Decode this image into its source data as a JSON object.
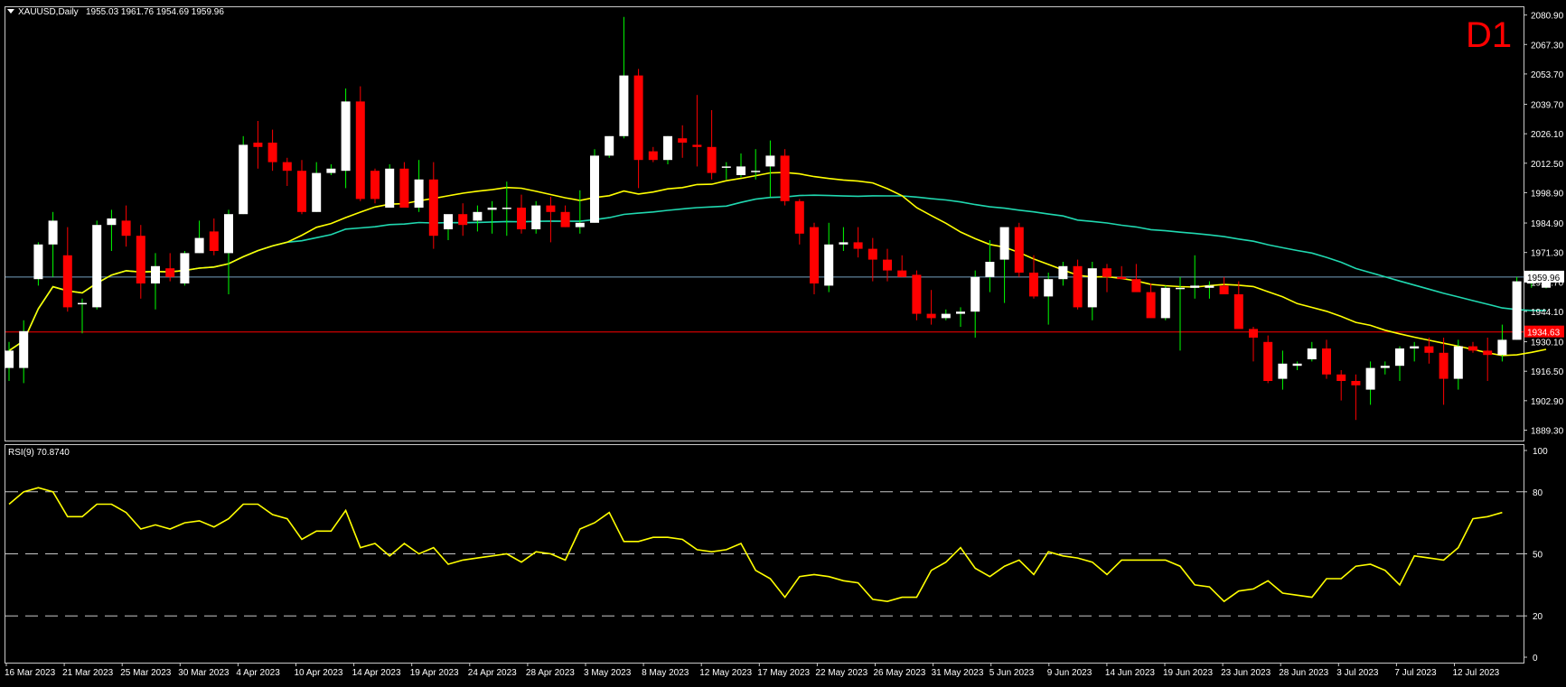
{
  "header": {
    "symbol": "XAUUSD,Daily",
    "ohlc": "1955.03 1961.76 1954.69 1959.96",
    "timeframe_badge": "D1",
    "rsi_label": "RSI(9) 70.8740"
  },
  "colors": {
    "background": "#000000",
    "frame": "#c8c8c8",
    "bull": "#ffffff",
    "bear": "#ff0000",
    "wick_up": "#00ff00",
    "wick_down": "#ff0000",
    "ma_fast": "#ffff00",
    "ma_slow": "#20d8b0",
    "rsi": "#ffff00",
    "badge": "#ff0000",
    "ref_line_red": "#ff0000",
    "ref_line_blue": "#9fd8ff"
  },
  "chart_data": [
    {
      "type": "candlestick",
      "ylim": [
        1884.5,
        2084.5
      ],
      "y_ticks": [
        "2080.90",
        "2067.30",
        "2053.70",
        "2039.70",
        "2026.10",
        "2012.50",
        "1998.90",
        "1984.90",
        "1971.30",
        "1957.70",
        "1944.10",
        "1930.10",
        "1916.50",
        "1902.90",
        "1889.30"
      ],
      "x_ticks": [
        "16 Mar 2023",
        "21 Mar 2023",
        "25 Mar 2023",
        "30 Mar 2023",
        "4 Apr 2023",
        "10 Apr 2023",
        "14 Apr 2023",
        "19 Apr 2023",
        "24 Apr 2023",
        "28 Apr 2023",
        "3 May 2023",
        "8 May 2023",
        "12 May 2023",
        "17 May 2023",
        "22 May 2023",
        "26 May 2023",
        "31 May 2023",
        "5 Jun 2023",
        "9 Jun 2023",
        "14 Jun 2023",
        "19 Jun 2023",
        "23 Jun 2023",
        "28 Jun 2023",
        "3 Jul 2023",
        "7 Jul 2023",
        "12 Jul 2023"
      ],
      "price_labels": [
        {
          "value": 1959.96,
          "text": "1959.96",
          "role": "current"
        },
        {
          "value": 1934.63,
          "text": "1934.63",
          "role": "reference"
        }
      ],
      "series": [
        {
          "name": "XAUUSD,Daily",
          "candles": [
            {
              "o": 1918,
              "h": 1930,
              "l": 1912,
              "c": 1926
            },
            {
              "o": 1918,
              "h": 1940,
              "l": 1911,
              "c": 1935
            },
            {
              "o": 1959,
              "h": 1976,
              "l": 1956,
              "c": 1975
            },
            {
              "o": 1975,
              "h": 1990,
              "l": 1960,
              "c": 1986
            },
            {
              "o": 1970,
              "h": 1983,
              "l": 1944,
              "c": 1946
            },
            {
              "o": 1948,
              "h": 1950,
              "l": 1934,
              "c": 1948
            },
            {
              "o": 1946,
              "h": 1986,
              "l": 1945,
              "c": 1984
            },
            {
              "o": 1984,
              "h": 1991,
              "l": 1972,
              "c": 1987
            },
            {
              "o": 1986,
              "h": 1993,
              "l": 1974,
              "c": 1979
            },
            {
              "o": 1979,
              "h": 1984,
              "l": 1950,
              "c": 1957
            },
            {
              "o": 1957,
              "h": 1971,
              "l": 1945,
              "c": 1965
            },
            {
              "o": 1964,
              "h": 1971,
              "l": 1958,
              "c": 1960
            },
            {
              "o": 1957,
              "h": 1972,
              "l": 1956,
              "c": 1971
            },
            {
              "o": 1971,
              "h": 1986,
              "l": 1971,
              "c": 1978
            },
            {
              "o": 1981,
              "h": 1987,
              "l": 1970,
              "c": 1972
            },
            {
              "o": 1971,
              "h": 1991,
              "l": 1952,
              "c": 1989
            },
            {
              "o": 1989,
              "h": 2025,
              "l": 1989,
              "c": 2021
            },
            {
              "o": 2022,
              "h": 2032,
              "l": 2010,
              "c": 2020
            },
            {
              "o": 2022,
              "h": 2028,
              "l": 2009,
              "c": 2013
            },
            {
              "o": 2013,
              "h": 2015,
              "l": 2002,
              "c": 2009
            },
            {
              "o": 2009,
              "h": 2014,
              "l": 1989,
              "c": 1990
            },
            {
              "o": 1990,
              "h": 2013,
              "l": 1990,
              "c": 2008
            },
            {
              "o": 2008,
              "h": 2012,
              "l": 2007,
              "c": 2010
            },
            {
              "o": 2009,
              "h": 2047,
              "l": 2001,
              "c": 2041
            },
            {
              "o": 2041,
              "h": 2048,
              "l": 1995,
              "c": 1996
            },
            {
              "o": 2009,
              "h": 2010,
              "l": 1994,
              "c": 1996
            },
            {
              "o": 1992,
              "h": 2012,
              "l": 1995,
              "c": 2010
            },
            {
              "o": 2010,
              "h": 2013,
              "l": 1992,
              "c": 1992
            },
            {
              "o": 1992,
              "h": 2014,
              "l": 1990,
              "c": 2005
            },
            {
              "o": 2005,
              "h": 2013,
              "l": 1973,
              "c": 1979
            },
            {
              "o": 1982,
              "h": 1987,
              "l": 1977,
              "c": 1989
            },
            {
              "o": 1989,
              "h": 1994,
              "l": 1979,
              "c": 1984
            },
            {
              "o": 1986,
              "h": 1993,
              "l": 1981,
              "c": 1990
            },
            {
              "o": 1991,
              "h": 1995,
              "l": 1980,
              "c": 1992
            },
            {
              "o": 1992,
              "h": 2004,
              "l": 1979,
              "c": 1992
            },
            {
              "o": 1992,
              "h": 1998,
              "l": 1980,
              "c": 1982
            },
            {
              "o": 1982,
              "h": 1995,
              "l": 1980,
              "c": 1993
            },
            {
              "o": 1993,
              "h": 1997,
              "l": 1976,
              "c": 1990
            },
            {
              "o": 1990,
              "h": 1993,
              "l": 1983,
              "c": 1983
            },
            {
              "o": 1983,
              "h": 2000,
              "l": 1980,
              "c": 1985
            },
            {
              "o": 1985,
              "h": 2019,
              "l": 1985,
              "c": 2016
            },
            {
              "o": 2016,
              "h": 2025,
              "l": 2015,
              "c": 2025
            },
            {
              "o": 2025,
              "h": 2080,
              "l": 2024,
              "c": 2053
            },
            {
              "o": 2053,
              "h": 2056,
              "l": 2001,
              "c": 2014
            },
            {
              "o": 2018,
              "h": 2020,
              "l": 2013,
              "c": 2014
            },
            {
              "o": 2014,
              "h": 2025,
              "l": 2012,
              "c": 2025
            },
            {
              "o": 2024,
              "h": 2030,
              "l": 2015,
              "c": 2022
            },
            {
              "o": 2021,
              "h": 2044,
              "l": 2011,
              "c": 2020
            },
            {
              "o": 2020,
              "h": 2037,
              "l": 2005,
              "c": 2008
            },
            {
              "o": 2011,
              "h": 2013,
              "l": 2005,
              "c": 2011
            },
            {
              "o": 2007,
              "h": 2017,
              "l": 2006,
              "c": 2011
            },
            {
              "o": 2009,
              "h": 2019,
              "l": 2005,
              "c": 2009
            },
            {
              "o": 2011,
              "h": 2023,
              "l": 1997,
              "c": 2016
            },
            {
              "o": 2016,
              "h": 2019,
              "l": 1993,
              "c": 1995
            },
            {
              "o": 1995,
              "h": 1996,
              "l": 1975,
              "c": 1980
            },
            {
              "o": 1983,
              "h": 1985,
              "l": 1952,
              "c": 1957
            },
            {
              "o": 1956,
              "h": 1985,
              "l": 1953,
              "c": 1975
            },
            {
              "o": 1975,
              "h": 1983,
              "l": 1972,
              "c": 1976
            },
            {
              "o": 1976,
              "h": 1983,
              "l": 1969,
              "c": 1973
            },
            {
              "o": 1973,
              "h": 1978,
              "l": 1958,
              "c": 1968
            },
            {
              "o": 1968,
              "h": 1973,
              "l": 1958,
              "c": 1963
            },
            {
              "o": 1963,
              "h": 1970,
              "l": 1960,
              "c": 1960
            },
            {
              "o": 1961,
              "h": 1963,
              "l": 1940,
              "c": 1943
            },
            {
              "o": 1943,
              "h": 1954,
              "l": 1938,
              "c": 1941
            },
            {
              "o": 1941,
              "h": 1945,
              "l": 1940,
              "c": 1943
            },
            {
              "o": 1943,
              "h": 1946,
              "l": 1937,
              "c": 1944
            },
            {
              "o": 1944,
              "h": 1963,
              "l": 1932,
              "c": 1960
            },
            {
              "o": 1960,
              "h": 1977,
              "l": 1953,
              "c": 1967
            },
            {
              "o": 1968,
              "h": 1982,
              "l": 1948,
              "c": 1983
            },
            {
              "o": 1983,
              "h": 1985,
              "l": 1960,
              "c": 1962
            },
            {
              "o": 1962,
              "h": 1970,
              "l": 1950,
              "c": 1951
            },
            {
              "o": 1951,
              "h": 1962,
              "l": 1938,
              "c": 1959
            },
            {
              "o": 1959,
              "h": 1967,
              "l": 1956,
              "c": 1965
            },
            {
              "o": 1965,
              "h": 1968,
              "l": 1945,
              "c": 1946
            },
            {
              "o": 1946,
              "h": 1967,
              "l": 1940,
              "c": 1964
            },
            {
              "o": 1964,
              "h": 1966,
              "l": 1953,
              "c": 1960
            },
            {
              "o": 1960,
              "h": 1965,
              "l": 1959,
              "c": 1959
            },
            {
              "o": 1959,
              "h": 1966,
              "l": 1955,
              "c": 1953
            },
            {
              "o": 1953,
              "h": 1957,
              "l": 1943,
              "c": 1941
            },
            {
              "o": 1941,
              "h": 1956,
              "l": 1940,
              "c": 1955
            },
            {
              "o": 1955,
              "h": 1960,
              "l": 1926,
              "c": 1955
            },
            {
              "o": 1955,
              "h": 1970,
              "l": 1950,
              "c": 1956
            },
            {
              "o": 1955,
              "h": 1958,
              "l": 1950,
              "c": 1956
            },
            {
              "o": 1956,
              "h": 1960,
              "l": 1952,
              "c": 1952
            },
            {
              "o": 1952,
              "h": 1958,
              "l": 1943,
              "c": 1936
            },
            {
              "o": 1936,
              "h": 1937,
              "l": 1921,
              "c": 1932
            },
            {
              "o": 1930,
              "h": 1933,
              "l": 1911,
              "c": 1912
            },
            {
              "o": 1913,
              "h": 1926,
              "l": 1908,
              "c": 1920
            },
            {
              "o": 1919,
              "h": 1921,
              "l": 1917,
              "c": 1920
            },
            {
              "o": 1922,
              "h": 1930,
              "l": 1921,
              "c": 1927
            },
            {
              "o": 1927,
              "h": 1931,
              "l": 1913,
              "c": 1915
            },
            {
              "o": 1915,
              "h": 1917,
              "l": 1903,
              "c": 1912
            },
            {
              "o": 1912,
              "h": 1915,
              "l": 1894,
              "c": 1910
            },
            {
              "o": 1908,
              "h": 1921,
              "l": 1901,
              "c": 1918
            },
            {
              "o": 1918,
              "h": 1921,
              "l": 1915,
              "c": 1919
            },
            {
              "o": 1919,
              "h": 1928,
              "l": 1912,
              "c": 1927
            },
            {
              "o": 1927,
              "h": 1930,
              "l": 1921,
              "c": 1928
            },
            {
              "o": 1928,
              "h": 1932,
              "l": 1920,
              "c": 1925
            },
            {
              "o": 1925,
              "h": 1932,
              "l": 1901,
              "c": 1913
            },
            {
              "o": 1913,
              "h": 1931,
              "l": 1908,
              "c": 1928
            },
            {
              "o": 1928,
              "h": 1930,
              "l": 1925,
              "c": 1926
            },
            {
              "o": 1926,
              "h": 1932,
              "l": 1912,
              "c": 1924
            },
            {
              "o": 1924,
              "h": 1938,
              "l": 1921,
              "c": 1931
            },
            {
              "o": 1931,
              "h": 1960,
              "l": 1931,
              "c": 1958
            },
            {
              "o": 1957,
              "h": 1963,
              "l": 1955,
              "c": 1959
            },
            {
              "o": 1955.03,
              "h": 1961.76,
              "l": 1954.69,
              "c": 1959.96
            }
          ]
        }
      ]
    },
    {
      "type": "line",
      "ylim": [
        0,
        100
      ],
      "y_ticks": [
        "100",
        "80",
        "50",
        "20",
        "0"
      ],
      "levels": [
        80,
        50,
        20
      ],
      "series": [
        {
          "name": "RSI(9) 70.8740",
          "values": [
            74,
            80,
            82,
            80,
            68,
            68,
            74,
            74,
            70,
            62,
            64,
            62,
            65,
            66,
            63,
            67,
            74,
            74,
            69,
            67,
            57,
            61,
            61,
            71,
            53,
            55,
            49,
            55,
            50,
            53,
            45,
            47,
            48,
            49,
            50,
            46,
            51,
            50,
            47,
            62,
            65,
            70,
            56,
            56,
            58,
            58,
            57,
            52,
            51,
            52,
            55,
            42,
            38,
            29,
            39,
            40,
            39,
            37,
            36,
            28,
            27,
            29,
            29,
            42,
            46,
            53,
            43,
            39,
            44,
            47,
            40,
            51,
            49,
            48,
            46,
            40,
            47,
            47,
            47,
            47,
            44,
            35,
            34,
            27,
            32,
            33,
            37,
            31,
            30,
            29,
            38,
            38,
            44,
            45,
            42,
            35,
            49,
            48,
            47,
            53,
            67,
            68,
            70
          ]
        }
      ]
    }
  ]
}
